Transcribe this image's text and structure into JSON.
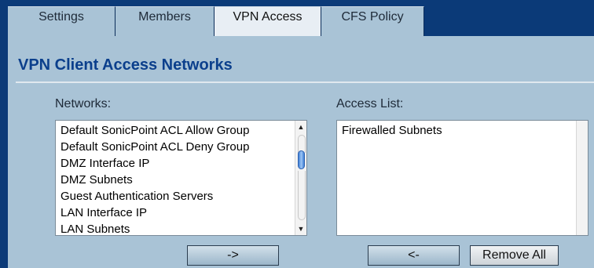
{
  "tabs": [
    {
      "label": "Settings"
    },
    {
      "label": "Members"
    },
    {
      "label": "VPN Access"
    },
    {
      "label": "CFS Policy"
    }
  ],
  "active_tab": "VPN Access",
  "section_title": "VPN Client Access Networks",
  "networks": {
    "label": "Networks:",
    "items": [
      "Default SonicPoint ACL Allow Group",
      "Default SonicPoint ACL Deny Group",
      "DMZ Interface IP",
      "DMZ Subnets",
      "Guest Authentication Servers",
      "LAN Interface IP",
      "LAN Subnets"
    ]
  },
  "access_list": {
    "label": "Access List:",
    "items": [
      "Firewalled Subnets"
    ]
  },
  "buttons": {
    "add": "->",
    "remove": "<-",
    "remove_all": "Remove All"
  },
  "icons": {
    "scroll_up": "up-arrow-icon",
    "scroll_down": "down-arrow-icon"
  }
}
